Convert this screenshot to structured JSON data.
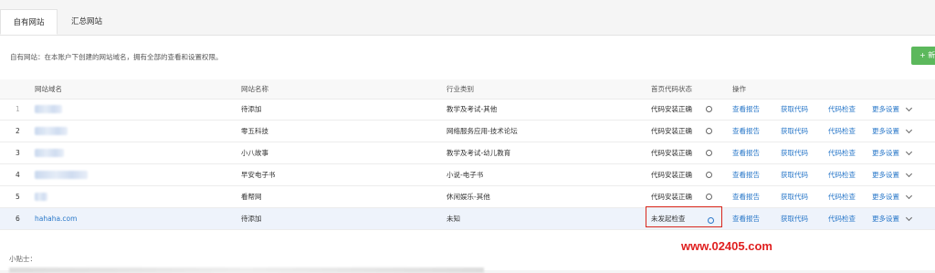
{
  "tabs": [
    {
      "label": "自有网站",
      "active": true
    },
    {
      "label": "汇总网站",
      "active": false
    }
  ],
  "description": "自有网站：在本账户下创建的网站域名，拥有全部的查看和设置权限。",
  "add_button_label": "+ 新",
  "table": {
    "headers": {
      "domain": "网站域名",
      "name": "网站名称",
      "industry": "行业类别",
      "status": "首页代码状态",
      "ops": "操作"
    },
    "rows": [
      {
        "idx": "1",
        "domain": "",
        "name": "待添加",
        "industry": "教学及考试-其他",
        "status": "代码安装正确"
      },
      {
        "idx": "2",
        "domain": "",
        "name": "零五科技",
        "industry": "网络服务应用-技术论坛",
        "status": "代码安装正确"
      },
      {
        "idx": "3",
        "domain": "",
        "name": "小八故事",
        "industry": "教学及考试-幼儿教育",
        "status": "代码安装正确"
      },
      {
        "idx": "4",
        "domain": "",
        "name": "早安电子书",
        "industry": "小说-电子书",
        "status": "代码安装正确"
      },
      {
        "idx": "5",
        "domain": "",
        "name": "看帮网",
        "industry": "休闲娱乐-其他",
        "status": "代码安装正确"
      },
      {
        "idx": "6",
        "domain": "hahaha.com",
        "name": "待添加",
        "industry": "未知",
        "status": "未发起检查"
      }
    ],
    "actions": {
      "view_report": "查看报告",
      "get_code": "获取代码",
      "check_code": "代码检查",
      "more_settings": "更多设置"
    }
  },
  "tips_label": "小贴士：",
  "watermark": "www.02405.com",
  "colors": {
    "link": "#2a78c9",
    "add_button": "#5cb85c",
    "highlight_box": "#d9261c",
    "watermark": "#e02020"
  }
}
